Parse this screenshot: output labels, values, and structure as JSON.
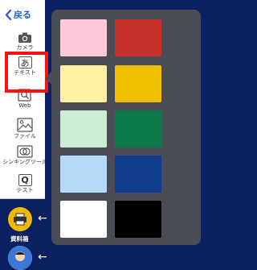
{
  "toolbar": {
    "back_label": "戻る",
    "items": [
      {
        "label": "カメラ",
        "icon": "camera-icon"
      },
      {
        "label": "テキスト",
        "icon": "text-box-icon",
        "glyph": "あ"
      },
      {
        "label": "Web",
        "icon": "web-search-icon"
      },
      {
        "label": "ファイル",
        "icon": "image-file-icon"
      },
      {
        "label": "シンキングツール",
        "icon": "thinking-tool-icon"
      },
      {
        "label": "テスト",
        "icon": "test-icon",
        "glyph": "Q"
      }
    ]
  },
  "bottom": {
    "material_label": "資料箱",
    "material_icon": "printer-icon",
    "avatar_icon": "user-avatar-icon"
  },
  "palette": {
    "colors": [
      [
        "#ffc8d9",
        "#c9302c"
      ],
      [
        "#fff2a0",
        "#f2c000"
      ],
      [
        "#cdeed3",
        "#0a7a4a"
      ],
      [
        "#b5daf8",
        "#0f3d8c"
      ],
      [
        "#ffffff",
        "#000000"
      ]
    ]
  },
  "theme": {
    "background": "#0a2060",
    "highlight": "#ff1010",
    "accent": "#1a5fd0",
    "palette_bg": "#4a4d55",
    "material_button": "#f0b800"
  }
}
